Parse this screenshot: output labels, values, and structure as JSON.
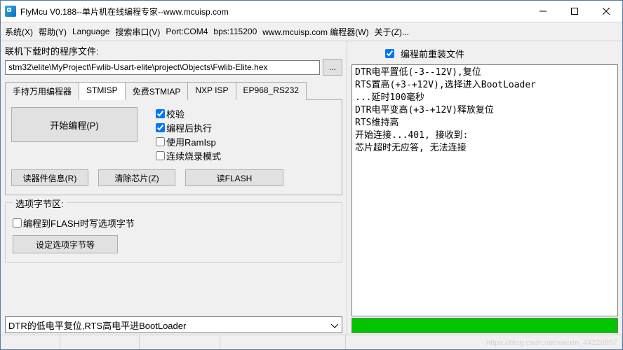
{
  "title": "FlyMcu V0.188--单片机在线编程专家--www.mcuisp.com",
  "menu": {
    "system": "系统(X)",
    "help": "帮助(Y)",
    "language": "Language",
    "search_port": "搜索串口(V)",
    "port": "Port:COM4",
    "bps": "bps:115200",
    "site": "www.mcuisp.com 编程器(W)",
    "about": "关于(Z)..."
  },
  "left": {
    "file_label": "联机下载时的程序文件:",
    "file_path": "stm32\\elite\\MyProject\\Fwlib-Usart-elite\\project\\Objects\\Fwlib-Elite.hex",
    "browse": "...",
    "tabs": {
      "t0": "手持万用编程器",
      "t1": "STMISP",
      "t2": "免费STMIAP",
      "t3": "NXP ISP",
      "t4": "EP968_RS232"
    },
    "start_prog": "开始编程(P)",
    "checks": {
      "verify": "校验",
      "run_after": "编程后执行",
      "use_ramisp": "使用RamIsp",
      "continuous": "连续烧录模式"
    },
    "reader_info": "读器件信息(R)",
    "erase_chip": "清除芯片(Z)",
    "read_flash": "读FLASH",
    "option_group_title": "选项字节区:",
    "opt_check": "编程到FLASH时写选项字节",
    "set_opt": "设定选项字节等",
    "bottom_combo": "DTR的低电平复位,RTS高电平进BootLoader"
  },
  "right": {
    "reinstall_label": "编程前重装文件",
    "log_lines": [
      "DTR电平置低(-3--12V),复位",
      "RTS置高(+3-+12V),选择进入BootLoader",
      "...延时100毫秒",
      "DTR电平变高(+3-+12V)释放复位",
      "RTS维持高",
      "开始连接...401, 接收到:",
      "芯片超时无应答, 无法连接"
    ]
  },
  "watermark": "https://blog.csdn.net/weixin_44226857"
}
